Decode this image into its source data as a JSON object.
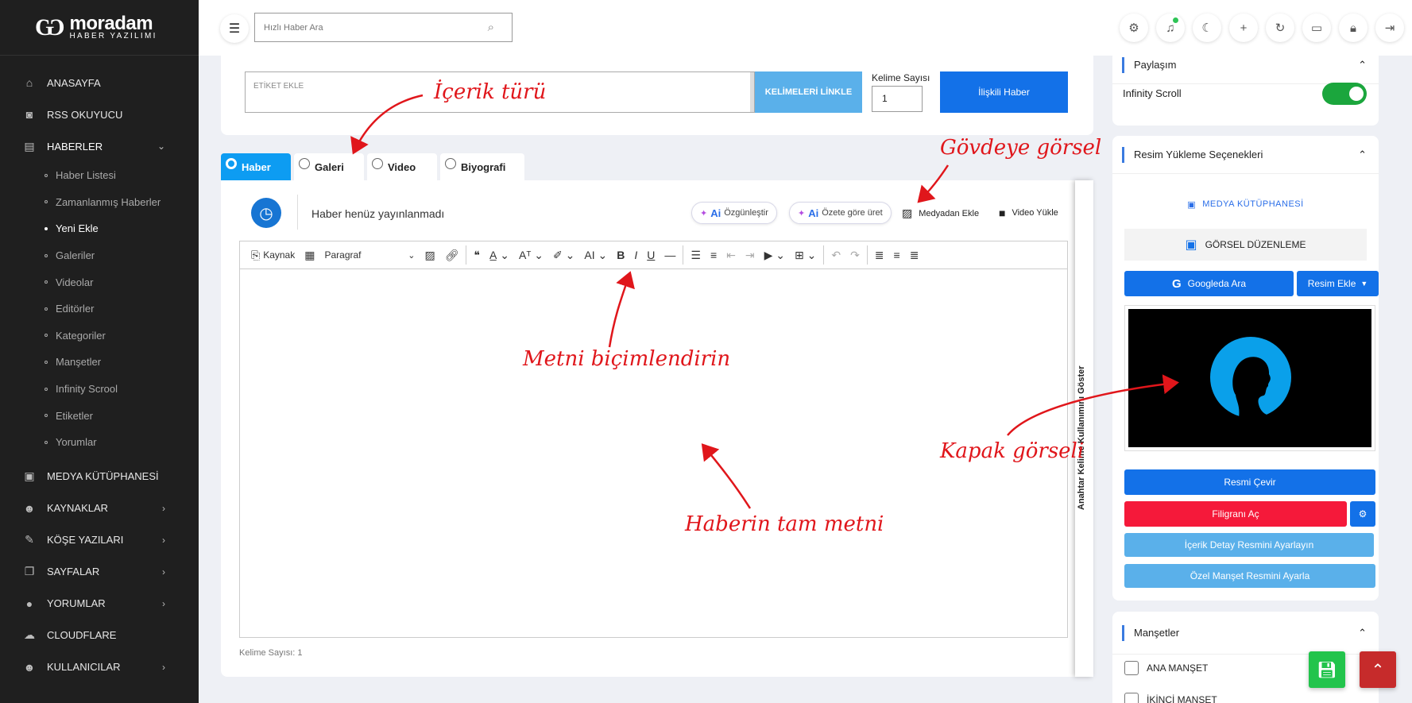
{
  "brand": {
    "name": "moradam",
    "tagline": "HABER YAZILIMI"
  },
  "sidebar": {
    "items": [
      {
        "label": "ANASAYFA",
        "icon": "home-icon"
      },
      {
        "label": "RSS OKUYUCU",
        "icon": "rss-icon"
      },
      {
        "label": "HABERLER",
        "icon": "newspaper-icon",
        "expanded": true
      }
    ],
    "subitems": [
      {
        "label": "Haber Listesi"
      },
      {
        "label": "Zamanlanmış Haberler"
      },
      {
        "label": "Yeni Ekle",
        "active": true
      },
      {
        "label": "Galeriler"
      },
      {
        "label": "Videolar"
      },
      {
        "label": "Editörler"
      },
      {
        "label": "Kategoriler"
      },
      {
        "label": "Manşetler"
      },
      {
        "label": "Infinity Scrool"
      },
      {
        "label": "Etiketler"
      },
      {
        "label": "Yorumlar"
      }
    ],
    "bottom_items": [
      {
        "label": "MEDYA KÜTÜPHANESİ",
        "icon": "image-icon"
      },
      {
        "label": "KAYNAKLAR",
        "icon": "users-icon"
      },
      {
        "label": "KÖŞE YAZILARI",
        "icon": "pen-icon"
      },
      {
        "label": "SAYFALAR",
        "icon": "pages-icon"
      },
      {
        "label": "YORUMLAR",
        "icon": "comment-icon"
      },
      {
        "label": "CLOUDFLARE",
        "icon": "cloud-icon"
      },
      {
        "label": "KULLANICILAR",
        "icon": "users-icon"
      }
    ]
  },
  "topbar": {
    "search_placeholder": "Hızlı Haber Ara",
    "icons": [
      "gear-icon",
      "bell-icon",
      "moon-icon",
      "plus-icon",
      "refresh-icon",
      "monitor-icon",
      "lock-icon",
      "logout-icon"
    ]
  },
  "tags": {
    "placeholder": "ETİKET EKLE",
    "link_button": "KELİMELERİ LİNKLE",
    "word_count_label": "Kelime Sayısı",
    "word_count_value": "1",
    "related_button": "İlişkili Haber"
  },
  "content_tabs": [
    {
      "label": "Haber",
      "active": true
    },
    {
      "label": "Galeri"
    },
    {
      "label": "Video"
    },
    {
      "label": "Biyografi"
    }
  ],
  "editor": {
    "status": "Haber henüz yayınlanmadı",
    "ai_rewrite": {
      "ai": "Ai",
      "label": "Özgünleştir"
    },
    "ai_summary": {
      "ai": "Ai",
      "label": "Özete göre üret"
    },
    "add_media": "Medyadan Ekle",
    "upload_video": "Video Yükle",
    "source_label": "Kaynak",
    "paragraph_label": "Paragraf",
    "footer_word_count": "Kelime Sayısı: 1",
    "side_strip": "Anahtar Kelime Kullanımını Göster"
  },
  "right_panel": {
    "share": {
      "title": "Paylaşım",
      "infinity_label": "Infinity Scroll",
      "infinity_on": true
    },
    "image_options": {
      "title": "Resim Yükleme Seçenekleri",
      "media_library": "MEDYA KÜTÜPHANESİ",
      "image_edit": "GÖRSEL DÜZENLEME",
      "google_search": "Googleda Ara",
      "add_image": "Resim Ekle",
      "rotate": "Resmi Çevir",
      "watermark": "Filigranı Aç",
      "detail_image": "İçerik Detay Resmini Ayarlayın",
      "headline_image": "Özel Manşet Resmini Ayarla"
    },
    "headlines": {
      "title": "Manşetler",
      "options": [
        "ANA MANŞET",
        "İKİNCİ MANŞET"
      ]
    }
  },
  "annotations": {
    "content_type": "İçerik türü",
    "body_image": "Gövdeye görsel",
    "format_text": "Metni biçimlendirin",
    "cover_image": "Kapak görseli",
    "full_text": "Haberin tam metni"
  },
  "colors": {
    "primary": "#1371e8",
    "sky": "#5ab0ea",
    "danger": "#f5193a",
    "success": "#1ba63d",
    "annotation": "#e0161b"
  }
}
